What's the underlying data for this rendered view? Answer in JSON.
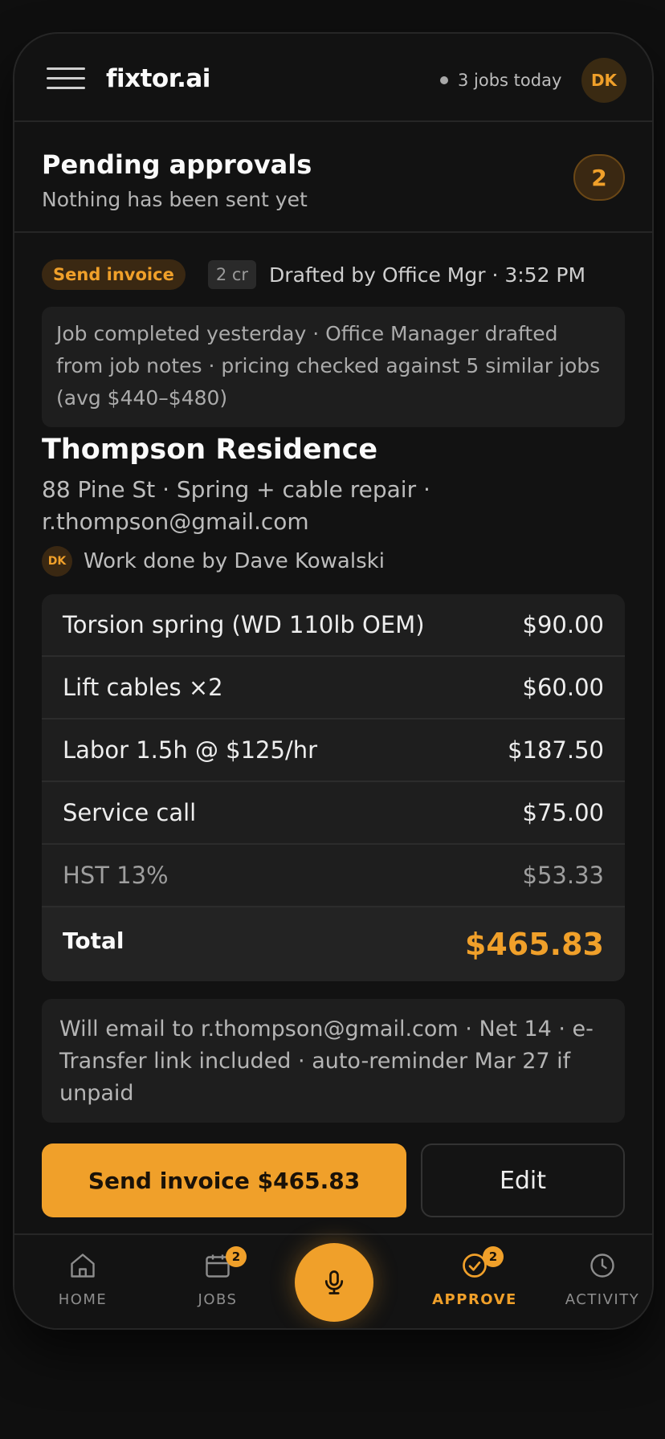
{
  "header": {
    "brand": "fixtor.ai",
    "status": "3 jobs today",
    "avatar": "DK"
  },
  "section": {
    "title": "Pending approvals",
    "subtitle": "Nothing has been sent yet",
    "count": "2"
  },
  "card": {
    "action_chip": "Send invoice",
    "credits_chip": "2 cr",
    "drafted": "Drafted by Office Mgr · 3:52 PM",
    "context": "Job completed yesterday · Office Manager drafted from job notes · pricing checked against 5 similar jobs (avg $440–$480)",
    "client_name": "Thompson Residence",
    "client_details": "88 Pine St · Spring + cable repair · r.thompson@gmail.com",
    "worker_initials": "DK",
    "worker": "Work done by Dave Kowalski",
    "line_items": [
      {
        "label": "Torsion spring (WD 110lb OEM)",
        "amount": "$90.00"
      },
      {
        "label": "Lift cables ×2",
        "amount": "$60.00"
      },
      {
        "label": "Labor 1.5h @ $125/hr",
        "amount": "$187.50"
      },
      {
        "label": "Service call",
        "amount": "$75.00"
      },
      {
        "label": "HST 13%",
        "amount": "$53.33"
      }
    ],
    "total_label": "Total",
    "total_amount": "$465.83",
    "email_note": "Will email to r.thompson@gmail.com · Net 14 · e-Transfer link included · auto-reminder Mar 27 if unpaid",
    "send_button": "Send invoice $465.83",
    "edit_button": "Edit"
  },
  "nav": {
    "items": [
      {
        "label": "HOME",
        "icon": "home-icon"
      },
      {
        "label": "JOBS",
        "icon": "calendar-icon",
        "badge": "2"
      },
      {
        "label": "",
        "icon": "microphone-icon"
      },
      {
        "label": "APPROVE",
        "icon": "check-circle-icon",
        "badge": "2",
        "active": true
      },
      {
        "label": "ACTIVITY",
        "icon": "clock-icon"
      }
    ]
  },
  "colors": {
    "accent": "#f0a02a",
    "background": "#121212",
    "surface": "#1e1e1e"
  }
}
